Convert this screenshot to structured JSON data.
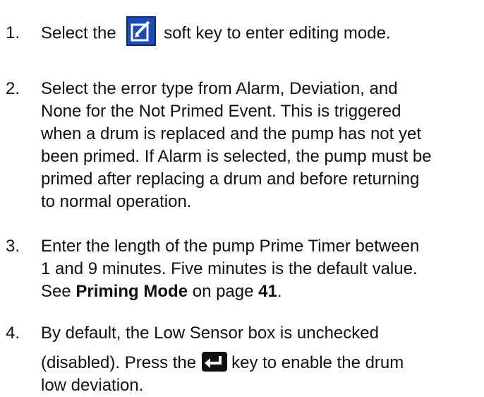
{
  "steps": [
    {
      "number": "1.",
      "before": "Select the",
      "icon": "edit-icon",
      "after": "soft key to enter editing mode."
    },
    {
      "number": "2.",
      "lines": [
        "Select the error type from Alarm, Deviation, and",
        "None for the Not Primed Event. This is triggered",
        "when a drum is replaced and the pump has not yet",
        "been primed. If Alarm is selected, the pump must be",
        "primed after replacing a drum and before returning",
        "to normal operation."
      ]
    },
    {
      "number": "3.",
      "lines": [
        "Enter the length of the pump Prime Timer between",
        "1 and 9 minutes. Five minutes is the default value."
      ],
      "see": "See",
      "ref_bold": "Priming Mode",
      "on_page": "on page",
      "page_num": "41",
      "period": "."
    },
    {
      "number": "4.",
      "line1": "By default, the Low Sensor box is unchecked",
      "line2_before": "(disabled). Press the",
      "icon": "enter-icon",
      "line2_after": "key to enable the drum",
      "line3": "low deviation."
    }
  ]
}
